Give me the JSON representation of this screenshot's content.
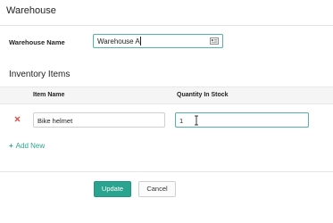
{
  "header": {
    "title": "Warehouse"
  },
  "form": {
    "warehouse_name_label": "Warehouse Name",
    "warehouse_name_value": "Warehouse A"
  },
  "inventory": {
    "section_title": "Inventory Items",
    "columns": [
      "Item Name",
      "Quantity In Stock"
    ],
    "rows": [
      {
        "item_name": "Bike helmet",
        "quantity": "1"
      }
    ],
    "add_new_label": "Add New"
  },
  "actions": {
    "update_label": "Update",
    "cancel_label": "Cancel"
  },
  "colors": {
    "accent": "#2aa48f",
    "delete": "#d9534f",
    "focus_border": "#53b3a6"
  },
  "icons": {
    "input_icon": "card-icon",
    "delete_icon": "close-icon",
    "add_icon": "plus-icon",
    "cursor": "text-cursor-icon"
  }
}
